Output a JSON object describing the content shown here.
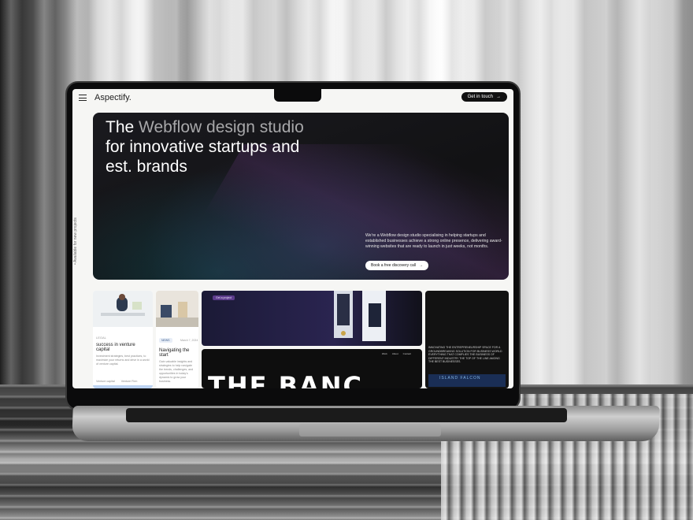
{
  "app": {
    "logo": "Aspectify.",
    "nav_cta": "Get in touch",
    "side_label": "• Available for new projects"
  },
  "hero": {
    "title_white_1": "The ",
    "title_dim": "Webflow design studio",
    "title_white_2": " for innovative startups and est. brands",
    "description": "We're a Webflow design studio specialising in helping startups and established businesses achieve a strong online presence, delivering award-winning websites that are ready to launch in just weeks, not months.",
    "button_label": "Book a free discovery call",
    "arrow": "→"
  },
  "cards": [
    {
      "label": "LEGAL",
      "title": "success in venture capital",
      "text": "Investment strategies, best practices, to maximize your returns and drive in a world of venture capital.",
      "footer_left": "Venture capital",
      "footer_right": "Venture Firm"
    },
    {
      "tag": "NEWS",
      "date": "March 7, 2024",
      "title": "Navigating the start",
      "text": "Gain valuable insights and strategies to help navigate the trends, challenges, and opportunities in today's dynamic to grow your business."
    }
  ],
  "tiles": {
    "badge": "Get a project",
    "brand_word": "THE BANC",
    "mini_nav": [
      "Work",
      "About",
      "Contact"
    ],
    "small_copy": "INNOVATING THE ENTREPRENEURSHIP SPACE FOR A GROUNDBREAKING SOLUTION FOR BUSINESS WORLD EVERYTHING THAT COMPLIES THE BUSINESS OF DIFFERENT INDUSTRY THE TOP OF THE LINE AMONG THE BEST BUSINESSES.",
    "falcon_label": "ISLAND FALCON"
  },
  "colors": {
    "hero_bg": "#121214",
    "accent_purple": "#5c3c8c",
    "falcon_blue": "#1a2e55"
  }
}
